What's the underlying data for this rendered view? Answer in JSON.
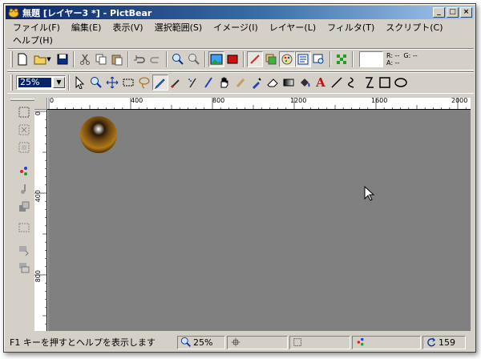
{
  "window": {
    "title": "無題 [レイヤー3 *] - PictBear",
    "buttons": {
      "minimize": "_",
      "maximize": "□",
      "close": "×"
    }
  },
  "menu": [
    "ファイル(F)",
    "編集(E)",
    "表示(V)",
    "選択範囲(S)",
    "イメージ(I)",
    "レイヤー(L)",
    "フィルタ(T)",
    "スクリプト(C)",
    "ヘルプ(H)"
  ],
  "toolbar1": {
    "icons": [
      "new-file-icon",
      "open-folder-icon",
      "save-icon",
      "cut-icon",
      "copy-icon",
      "paste-icon",
      "undo-icon",
      "redo-icon",
      "zoom-in-icon",
      "zoom-out-icon",
      "image-view-icon",
      "red-fill-icon",
      "brush-layer-icon",
      "layers-icon",
      "palette-icon",
      "properties-icon",
      "preview-icon",
      "grid-nodes-icon"
    ],
    "rgb_readout": {
      "r": "R: --",
      "g": "G: --",
      "a": "A: --"
    }
  },
  "toolbar2": {
    "zoom_value": "25%",
    "tools": [
      "pointer-tool",
      "zoom-tool",
      "move-tool",
      "rect-select-tool",
      "lasso-tool",
      "pencil-tool",
      "brush-tool",
      "airbrush-tool",
      "pen-tool",
      "hand-tool",
      "smudge-tool",
      "dropper-tool",
      "eraser-tool",
      "gradient-tool",
      "fill-tool",
      "text-tool",
      "line-tool",
      "curve-tool",
      "polyline-tool",
      "rectangle-tool",
      "ellipse-tool"
    ],
    "text_tool_label": "A"
  },
  "rulers": {
    "top_labels": [
      "0",
      "400",
      "800",
      "1200",
      "1600",
      "2000"
    ],
    "left_labels": [
      "0",
      "400",
      "800"
    ]
  },
  "status": {
    "help_text": "F1 キーを押すとヘルプを表示します",
    "zoom": "25%",
    "angle": "159"
  }
}
